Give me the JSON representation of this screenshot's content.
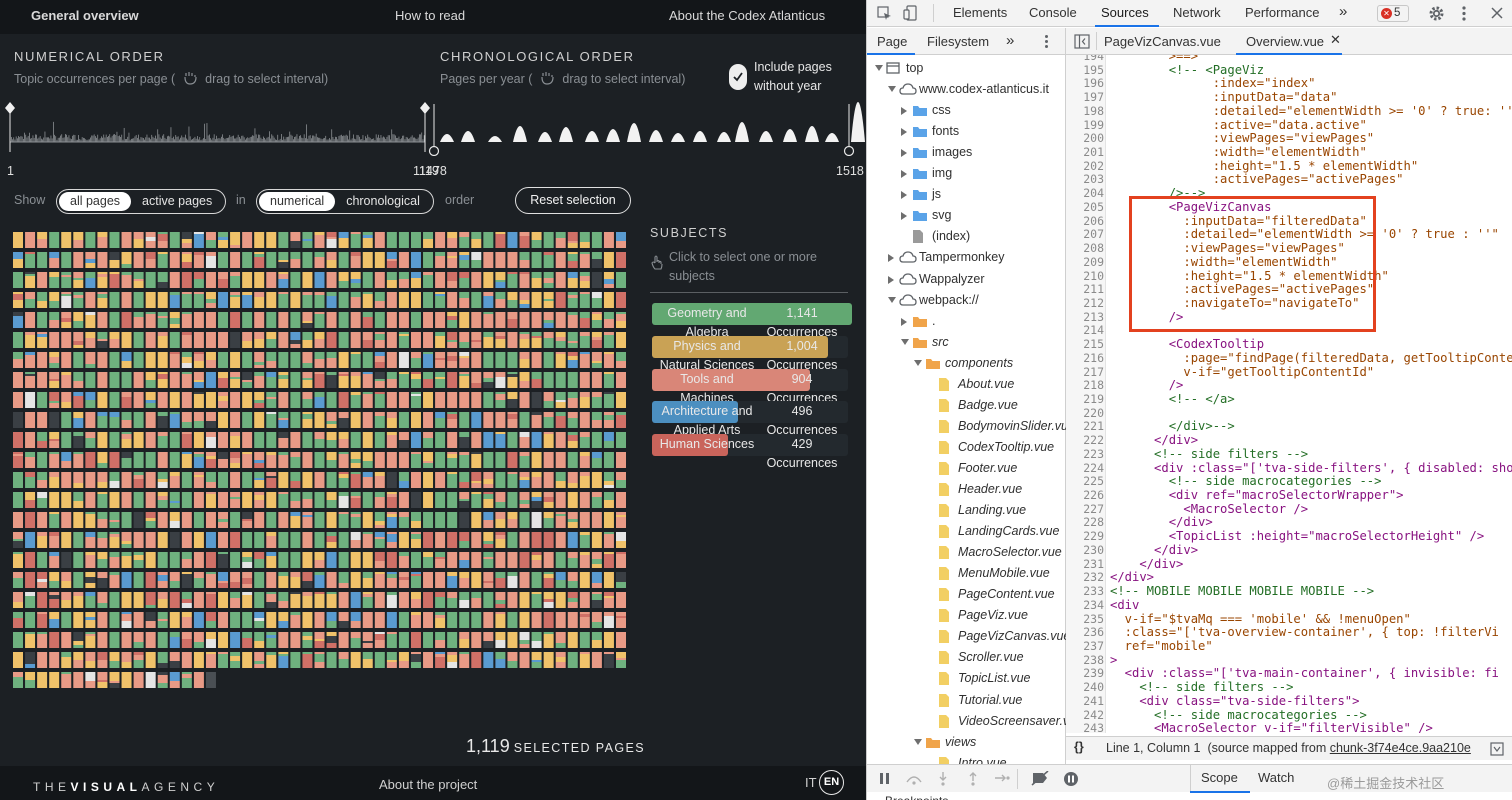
{
  "app": {
    "nav": {
      "brand": "General overview",
      "how_to_read": "How to read",
      "about_codex": "About the Codex Atlanticus"
    },
    "numerical_order": {
      "title": "NUMERICAL ORDER",
      "subtitle": "Topic occurrences per page (",
      "drag_hint": "drag to select interval)"
    },
    "chronological_order": {
      "title": "CHRONOLOGICAL ORDER",
      "subtitle": "Pages per year (",
      "drag_hint": "drag to select interval)"
    },
    "include_pages": "Include pages without year",
    "axis": {
      "num_start": "1",
      "num_end": "1119",
      "chrono_start": "1478",
      "chrono_end": "1518"
    },
    "filters": {
      "show_label": "Show",
      "in_label": "in",
      "order_label": "order",
      "show_options": [
        "all pages",
        "active pages"
      ],
      "show_selected": "all pages",
      "order_options": [
        "numerical",
        "chronological"
      ],
      "order_selected": "numerical",
      "reset_button": "Reset selection"
    },
    "subjects": {
      "title": "SUBJECTS",
      "hint": "Click to select one or more subjects",
      "items": [
        {
          "name": "Geometry and Algebra",
          "count": "1,141",
          "unit": "Occurrences",
          "color": "#62a872",
          "share": 1.0
        },
        {
          "name": "Physics and Natural Sciences",
          "count": "1,004",
          "unit": "Occurrences",
          "color": "#c9a255",
          "share": 0.88
        },
        {
          "name": "Tools and Machines",
          "count": "904",
          "unit": "Occurrences",
          "color": "#d98678",
          "share": 0.79
        },
        {
          "name": "Architecture and Applied Arts",
          "count": "496",
          "unit": "Occurrences",
          "color": "#4c8fc0",
          "share": 0.43
        },
        {
          "name": "Human Sciences",
          "count": "429",
          "unit": "Occurrences",
          "color": "#c9645b",
          "share": 0.38
        }
      ]
    },
    "selected": {
      "count": "1,119",
      "label": "SELECTED PAGES"
    },
    "footer": {
      "logo": "THEVISUALAGENCY",
      "logo_bold": "VISUAL",
      "about_project": "About the project",
      "lang_it": "IT",
      "lang_en": "EN"
    },
    "grid_palette": [
      "#e89a86",
      "#f0c26a",
      "#6fb17f",
      "#5a9bd0",
      "#d07067",
      "#e5e5e5",
      "#3a3f44"
    ]
  },
  "devtools": {
    "main_tabs": [
      "Elements",
      "Console",
      "Sources",
      "Network",
      "Performance"
    ],
    "active_tab": "Sources",
    "more_tabs": "»",
    "error_count": "5",
    "nav_tabs": [
      "Page",
      "Filesystem"
    ],
    "nav_more": "»",
    "tree": [
      {
        "label": "top",
        "depth": 0,
        "arrow": "down",
        "icon": "frame"
      },
      {
        "label": "www.codex-atlanticus.it",
        "depth": 1,
        "arrow": "down",
        "icon": "cloud"
      },
      {
        "label": "css",
        "depth": 2,
        "arrow": "right",
        "icon": "folder-blue"
      },
      {
        "label": "fonts",
        "depth": 2,
        "arrow": "right",
        "icon": "folder-blue"
      },
      {
        "label": "images",
        "depth": 2,
        "arrow": "right",
        "icon": "folder-blue"
      },
      {
        "label": "img",
        "depth": 2,
        "arrow": "right",
        "icon": "folder-blue"
      },
      {
        "label": "js",
        "depth": 2,
        "arrow": "right",
        "icon": "folder-blue"
      },
      {
        "label": "svg",
        "depth": 2,
        "arrow": "right",
        "icon": "folder-blue"
      },
      {
        "label": "(index)",
        "depth": 2,
        "arrow": "",
        "icon": "file-gray"
      },
      {
        "label": "Tampermonkey",
        "depth": 1,
        "arrow": "right",
        "icon": "cloud"
      },
      {
        "label": "Wappalyzer",
        "depth": 1,
        "arrow": "right",
        "icon": "cloud"
      },
      {
        "label": "webpack://",
        "depth": 1,
        "arrow": "down",
        "icon": "cloud"
      },
      {
        "label": ".",
        "depth": 2,
        "arrow": "right",
        "icon": "folder-orange"
      },
      {
        "label": "src",
        "depth": 2,
        "arrow": "down",
        "icon": "folder-orange",
        "italic": true
      },
      {
        "label": "components",
        "depth": 3,
        "arrow": "down",
        "icon": "folder-orange",
        "italic": true
      },
      {
        "label": "About.vue",
        "depth": 4,
        "arrow": "",
        "icon": "file-yellow",
        "italic": true
      },
      {
        "label": "Badge.vue",
        "depth": 4,
        "arrow": "",
        "icon": "file-yellow",
        "italic": true
      },
      {
        "label": "BodymovinSlider.vu",
        "depth": 4,
        "arrow": "",
        "icon": "file-yellow",
        "italic": true
      },
      {
        "label": "CodexTooltip.vue",
        "depth": 4,
        "arrow": "",
        "icon": "file-yellow",
        "italic": true
      },
      {
        "label": "Footer.vue",
        "depth": 4,
        "arrow": "",
        "icon": "file-yellow",
        "italic": true
      },
      {
        "label": "Header.vue",
        "depth": 4,
        "arrow": "",
        "icon": "file-yellow",
        "italic": true
      },
      {
        "label": "Landing.vue",
        "depth": 4,
        "arrow": "",
        "icon": "file-yellow",
        "italic": true
      },
      {
        "label": "LandingCards.vue",
        "depth": 4,
        "arrow": "",
        "icon": "file-yellow",
        "italic": true
      },
      {
        "label": "MacroSelector.vue",
        "depth": 4,
        "arrow": "",
        "icon": "file-yellow",
        "italic": true
      },
      {
        "label": "MenuMobile.vue",
        "depth": 4,
        "arrow": "",
        "icon": "file-yellow",
        "italic": true
      },
      {
        "label": "PageContent.vue",
        "depth": 4,
        "arrow": "",
        "icon": "file-yellow",
        "italic": true
      },
      {
        "label": "PageViz.vue",
        "depth": 4,
        "arrow": "",
        "icon": "file-yellow",
        "italic": true
      },
      {
        "label": "PageVizCanvas.vue",
        "depth": 4,
        "arrow": "",
        "icon": "file-yellow",
        "italic": true
      },
      {
        "label": "Scroller.vue",
        "depth": 4,
        "arrow": "",
        "icon": "file-yellow",
        "italic": true
      },
      {
        "label": "TopicList.vue",
        "depth": 4,
        "arrow": "",
        "icon": "file-yellow",
        "italic": true
      },
      {
        "label": "Tutorial.vue",
        "depth": 4,
        "arrow": "",
        "icon": "file-yellow",
        "italic": true
      },
      {
        "label": "VideoScreensaver.v",
        "depth": 4,
        "arrow": "",
        "icon": "file-yellow",
        "italic": true
      },
      {
        "label": "views",
        "depth": 3,
        "arrow": "down",
        "icon": "folder-orange",
        "italic": true
      },
      {
        "label": "Intro.vue",
        "depth": 4,
        "arrow": "",
        "icon": "file-yellow",
        "italic": true
      }
    ],
    "editor_tabs": [
      {
        "label": "PageVizCanvas.vue",
        "active": false
      },
      {
        "label": "Overview.vue",
        "active": true
      }
    ],
    "code_lines": [
      {
        "n": "194",
        "t": "        >==>"
      },
      {
        "n": "195",
        "t": "        <!-- <PageViz"
      },
      {
        "n": "196",
        "t": "              :index=\"index\""
      },
      {
        "n": "197",
        "t": "              :inputData=\"data\""
      },
      {
        "n": "198",
        "t": "              :detailed=\"elementWidth >= '0' ? true: ''\""
      },
      {
        "n": "199",
        "t": "              :active=\"data.active\""
      },
      {
        "n": "200",
        "t": "              :viewPages=\"viewPages\""
      },
      {
        "n": "201",
        "t": "              :width=\"elementWidth\""
      },
      {
        "n": "202",
        "t": "              :height=\"1.5 * elementWidth\""
      },
      {
        "n": "203",
        "t": "              :activePages=\"activePages\""
      },
      {
        "n": "204",
        "t": "        />-->"
      },
      {
        "n": "205",
        "t": "        <PageVizCanvas"
      },
      {
        "n": "206",
        "t": "          :inputData=\"filteredData\""
      },
      {
        "n": "207",
        "t": "          :detailed=\"elementWidth >= '0' ? true : ''\""
      },
      {
        "n": "208",
        "t": "          :viewPages=\"viewPages\""
      },
      {
        "n": "209",
        "t": "          :width=\"elementWidth\""
      },
      {
        "n": "210",
        "t": "          :height=\"1.5 * elementWidth\""
      },
      {
        "n": "211",
        "t": "          :activePages=\"activePages\""
      },
      {
        "n": "212",
        "t": "          :navigateTo=\"navigateTo\""
      },
      {
        "n": "213",
        "t": "        />"
      },
      {
        "n": "214",
        "t": ""
      },
      {
        "n": "215",
        "t": "        <CodexTooltip"
      },
      {
        "n": "216",
        "t": "          :page=\"findPage(filteredData, getTooltipConte"
      },
      {
        "n": "217",
        "t": "          v-if=\"getTooltipContentId\""
      },
      {
        "n": "218",
        "t": "        />"
      },
      {
        "n": "219",
        "t": "        <!-- </a>"
      },
      {
        "n": "220",
        "t": ""
      },
      {
        "n": "221",
        "t": "        </div>-->"
      },
      {
        "n": "222",
        "t": "      </div>"
      },
      {
        "n": "223",
        "t": "      <!-- side filters -->"
      },
      {
        "n": "224",
        "t": "      <div :class=\"['tva-side-filters', { disabled: sho"
      },
      {
        "n": "225",
        "t": "        <!-- side macrocategories -->"
      },
      {
        "n": "226",
        "t": "        <div ref=\"macroSelectorWrapper\">"
      },
      {
        "n": "227",
        "t": "          <MacroSelector />"
      },
      {
        "n": "228",
        "t": "        </div>"
      },
      {
        "n": "229",
        "t": "        <TopicList :height=\"macroSelectorHeight\" />"
      },
      {
        "n": "230",
        "t": "      </div>"
      },
      {
        "n": "231",
        "t": "    </div>"
      },
      {
        "n": "232",
        "t": "</div>"
      },
      {
        "n": "233",
        "t": "<!-- MOBILE MOBILE MOBILE MOBILE -->"
      },
      {
        "n": "234",
        "t": "<div"
      },
      {
        "n": "235",
        "t": "  v-if=\"$tvaMq === 'mobile' && !menuOpen\""
      },
      {
        "n": "236",
        "t": "  :class=\"['tva-overview-container', { top: !filterVi"
      },
      {
        "n": "237",
        "t": "  ref=\"mobile\""
      },
      {
        "n": "238",
        "t": ">"
      },
      {
        "n": "239",
        "t": "  <div :class=\"['tva-main-container', { invisible: fi"
      },
      {
        "n": "240",
        "t": "    <!-- side filters -->"
      },
      {
        "n": "241",
        "t": "    <div class=\"tva-side-filters\">"
      },
      {
        "n": "242",
        "t": "      <!-- side macrocategories -->"
      },
      {
        "n": "243",
        "t": "      <MacroSelector v-if=\"filterVisible\" />"
      }
    ],
    "status": {
      "braces": "{}",
      "position": "Line 1, Column 1",
      "mapped": "(source mapped from",
      "chunk": "chunk-3f74e4ce.9aa210e"
    },
    "debugger_tabs": [
      "Scope",
      "Watch"
    ],
    "watermark": "@稀土掘金技术社区",
    "breakpoints": "Breakpoints"
  }
}
